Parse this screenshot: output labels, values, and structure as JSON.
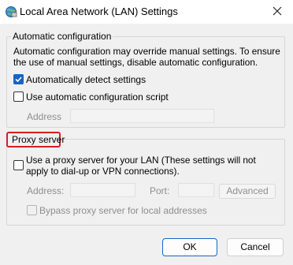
{
  "window": {
    "title": "Local Area Network (LAN) Settings",
    "icon": "network-settings-icon",
    "close_icon": "close-icon"
  },
  "automatic_configuration": {
    "legend": "Automatic configuration",
    "description": "Automatic configuration may override manual settings.  To ensure the use of manual settings, disable automatic configuration.",
    "auto_detect": {
      "label": "Automatically detect settings",
      "checked": true
    },
    "use_script": {
      "label": "Use automatic configuration script",
      "checked": false
    },
    "address_label": "Address",
    "address_value": ""
  },
  "proxy_server": {
    "legend": "Proxy server",
    "use_proxy": {
      "label": "Use a proxy server for your LAN (These settings will not apply to dial-up or VPN connections).",
      "checked": false
    },
    "address_label": "Address:",
    "address_value": "",
    "port_label": "Port:",
    "port_value": "",
    "advanced_label": "Advanced",
    "bypass": {
      "label": "Bypass proxy server for local addresses",
      "checked": false
    }
  },
  "buttons": {
    "ok_label": "OK",
    "cancel_label": "Cancel"
  },
  "colors": {
    "accent": "#1565c0",
    "highlight_border": "#d21f26",
    "background": "#f0f0f0"
  }
}
